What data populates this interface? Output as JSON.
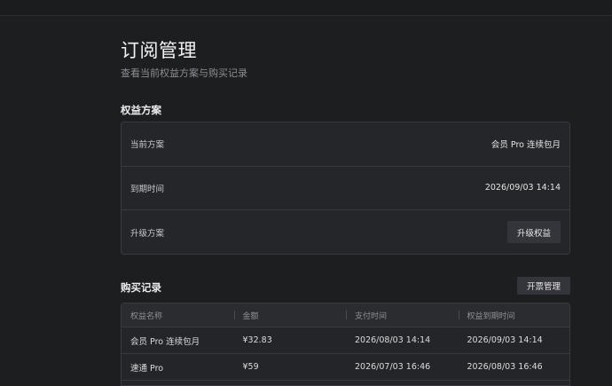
{
  "header": {
    "title": "订阅管理",
    "subtitle": "查看当前权益方案与购买记录"
  },
  "plan_section": {
    "title": "权益方案",
    "rows": [
      {
        "label": "当前方案",
        "value": "会员 Pro 连续包月"
      },
      {
        "label": "到期时间",
        "value": "2026/09/03 14:14"
      },
      {
        "label": "升级方案",
        "button": "升级权益"
      }
    ]
  },
  "purchase_section": {
    "title": "购买记录",
    "invoice_button": "开票管理",
    "columns": [
      "权益名称",
      "金额",
      "支付时间",
      "权益到期时间"
    ],
    "rows": [
      [
        "会员 Pro 连续包月",
        "¥32.83",
        "2026/08/03 14:14",
        "2026/09/03 14:14"
      ],
      [
        "速通 Pro",
        "¥59",
        "2026/07/03 16:46",
        "2026/08/03 16:46"
      ]
    ]
  },
  "colors": {
    "background": "#1d1e20",
    "card": "#252629",
    "border": "#393a3e",
    "button": "#34353a"
  }
}
